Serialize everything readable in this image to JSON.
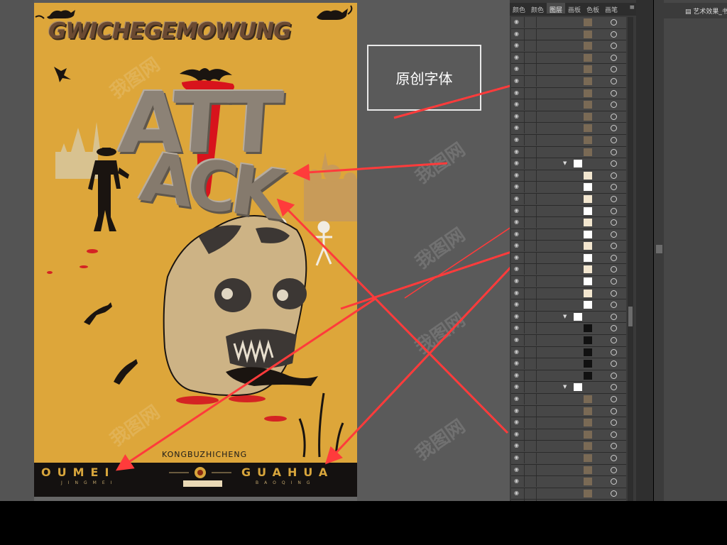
{
  "poster": {
    "top_title": "GWICHEGEMOWUNG",
    "att": "ATT",
    "ack": "ACK",
    "bottom_small": "KONGBUZHICHENG",
    "bottom_left": "OUMEI",
    "bottom_right": "GUAHUA",
    "bottom_sub_left": "JINGMEI",
    "bottom_sub_right": "BAOQING"
  },
  "callout": {
    "label": "原创字体"
  },
  "layers_panel": {
    "tabs": [
      "颜色",
      "颜色",
      "图层",
      "画板",
      "色板",
      "画笔"
    ],
    "active_tab": "图层",
    "menu_icon": "≡"
  },
  "far_panel": {
    "title": "艺术效果_书法"
  },
  "colors": {
    "poster_bg": "#dda63a",
    "arrow": "#ff3b3b",
    "panel_bg": "#3a3a3a"
  },
  "watermark": "我图网"
}
